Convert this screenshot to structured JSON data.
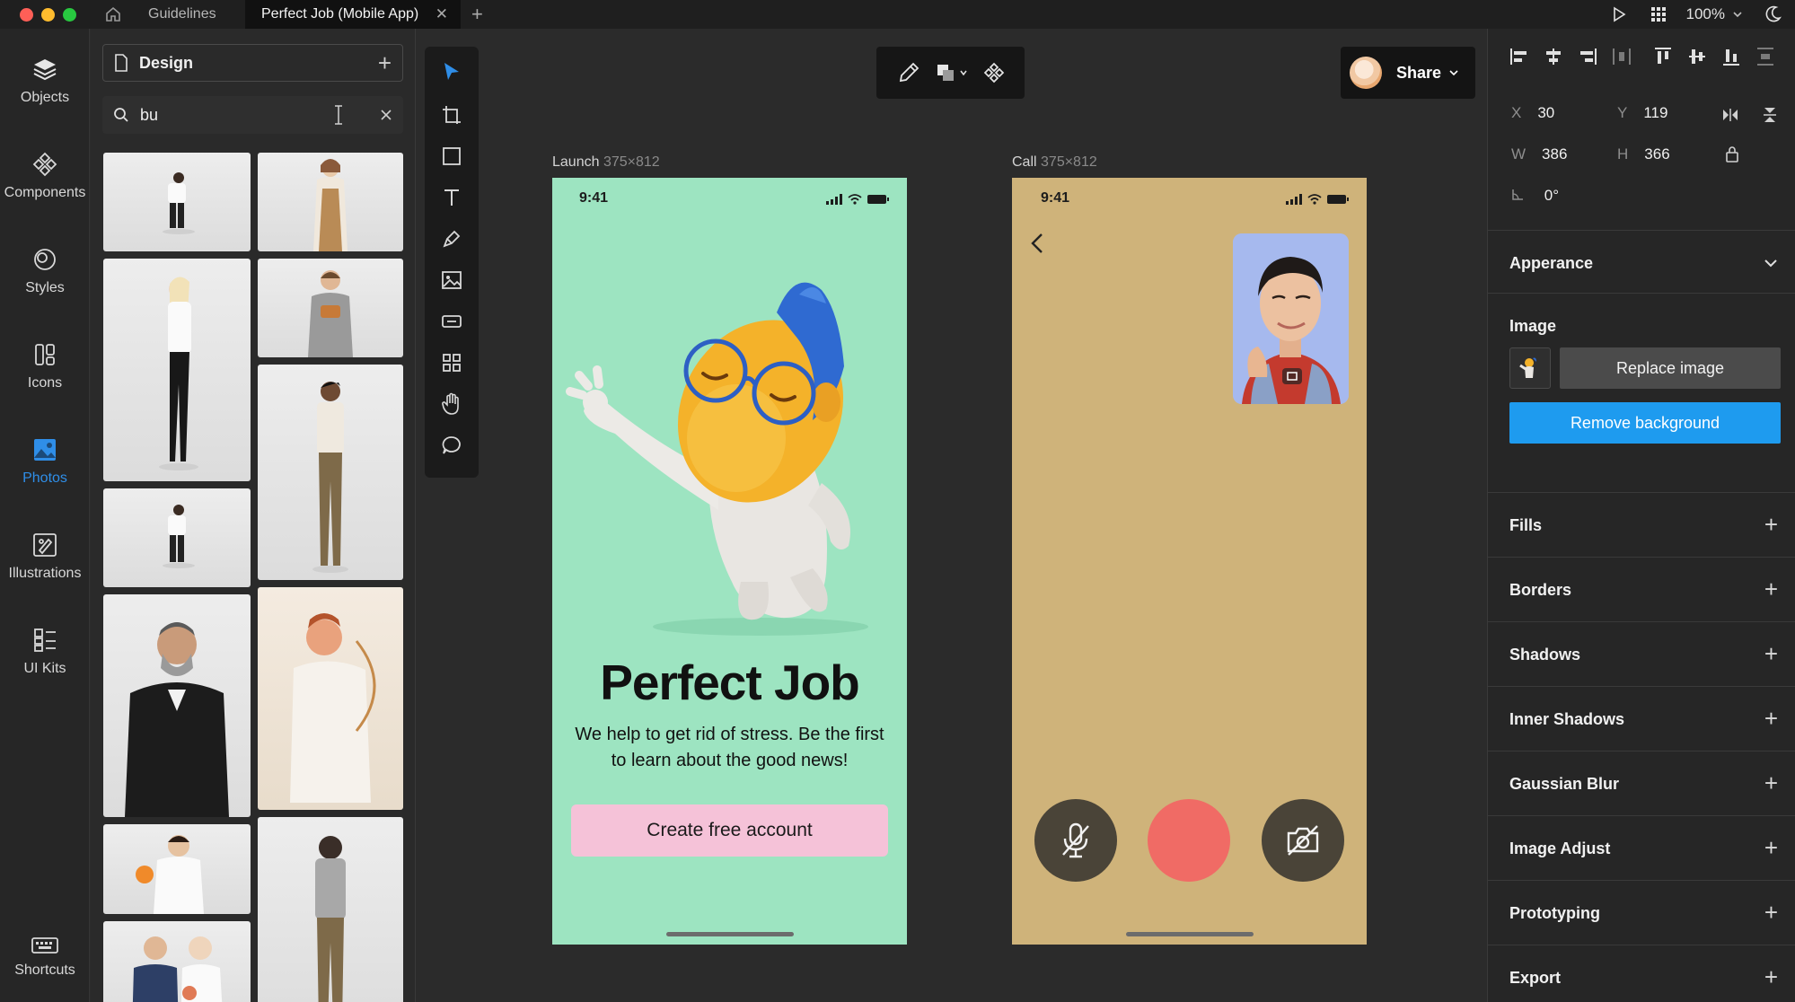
{
  "titlebar": {
    "tabs": [
      {
        "label": "Guidelines"
      },
      {
        "label": "Perfect Job (Mobile App)"
      }
    ],
    "zoom": "100%"
  },
  "rail": {
    "items": [
      {
        "label": "Objects",
        "icon": "layers-icon"
      },
      {
        "label": "Components",
        "icon": "components-icon"
      },
      {
        "label": "Styles",
        "icon": "styles-icon"
      },
      {
        "label": "Icons",
        "icon": "icons-icon"
      },
      {
        "label": "Photos",
        "icon": "photos-icon",
        "active": true
      },
      {
        "label": "Illustrations",
        "icon": "illustrations-icon"
      },
      {
        "label": "UI Kits",
        "icon": "ui-kits-icon"
      },
      {
        "label": "Shortcuts",
        "icon": "keyboard-icon"
      }
    ]
  },
  "assets": {
    "panel_title": "Design",
    "search_value": "bu"
  },
  "canvas": {
    "share_label": "Share",
    "frames": [
      {
        "name": "Launch",
        "size": "375×812"
      },
      {
        "name": "Call",
        "size": "375×812"
      }
    ],
    "launch": {
      "time": "9:41",
      "title": "Perfect Job",
      "subtitle": "We help to get rid of stress. Be the first to learn about the good news!",
      "cta": "Create free account",
      "bg_color": "#9de4c1"
    },
    "call": {
      "time": "9:41",
      "bg_color": "#cfb37a",
      "end_call_color": "#f06b65"
    }
  },
  "inspector": {
    "x_label": "X",
    "x": "30",
    "y_label": "Y",
    "y": "119",
    "w_label": "W",
    "w": "386",
    "h_label": "H",
    "h": "366",
    "rotation": "0°",
    "appearance": "Apperance",
    "image_title": "Image",
    "replace_image": "Replace image",
    "remove_background": "Remove background",
    "sections": [
      "Fills",
      "Borders",
      "Shadows",
      "Inner Shadows",
      "Gaussian Blur",
      "Image Adjust",
      "Prototyping",
      "Export"
    ],
    "accent_color": "#1e9bef"
  }
}
